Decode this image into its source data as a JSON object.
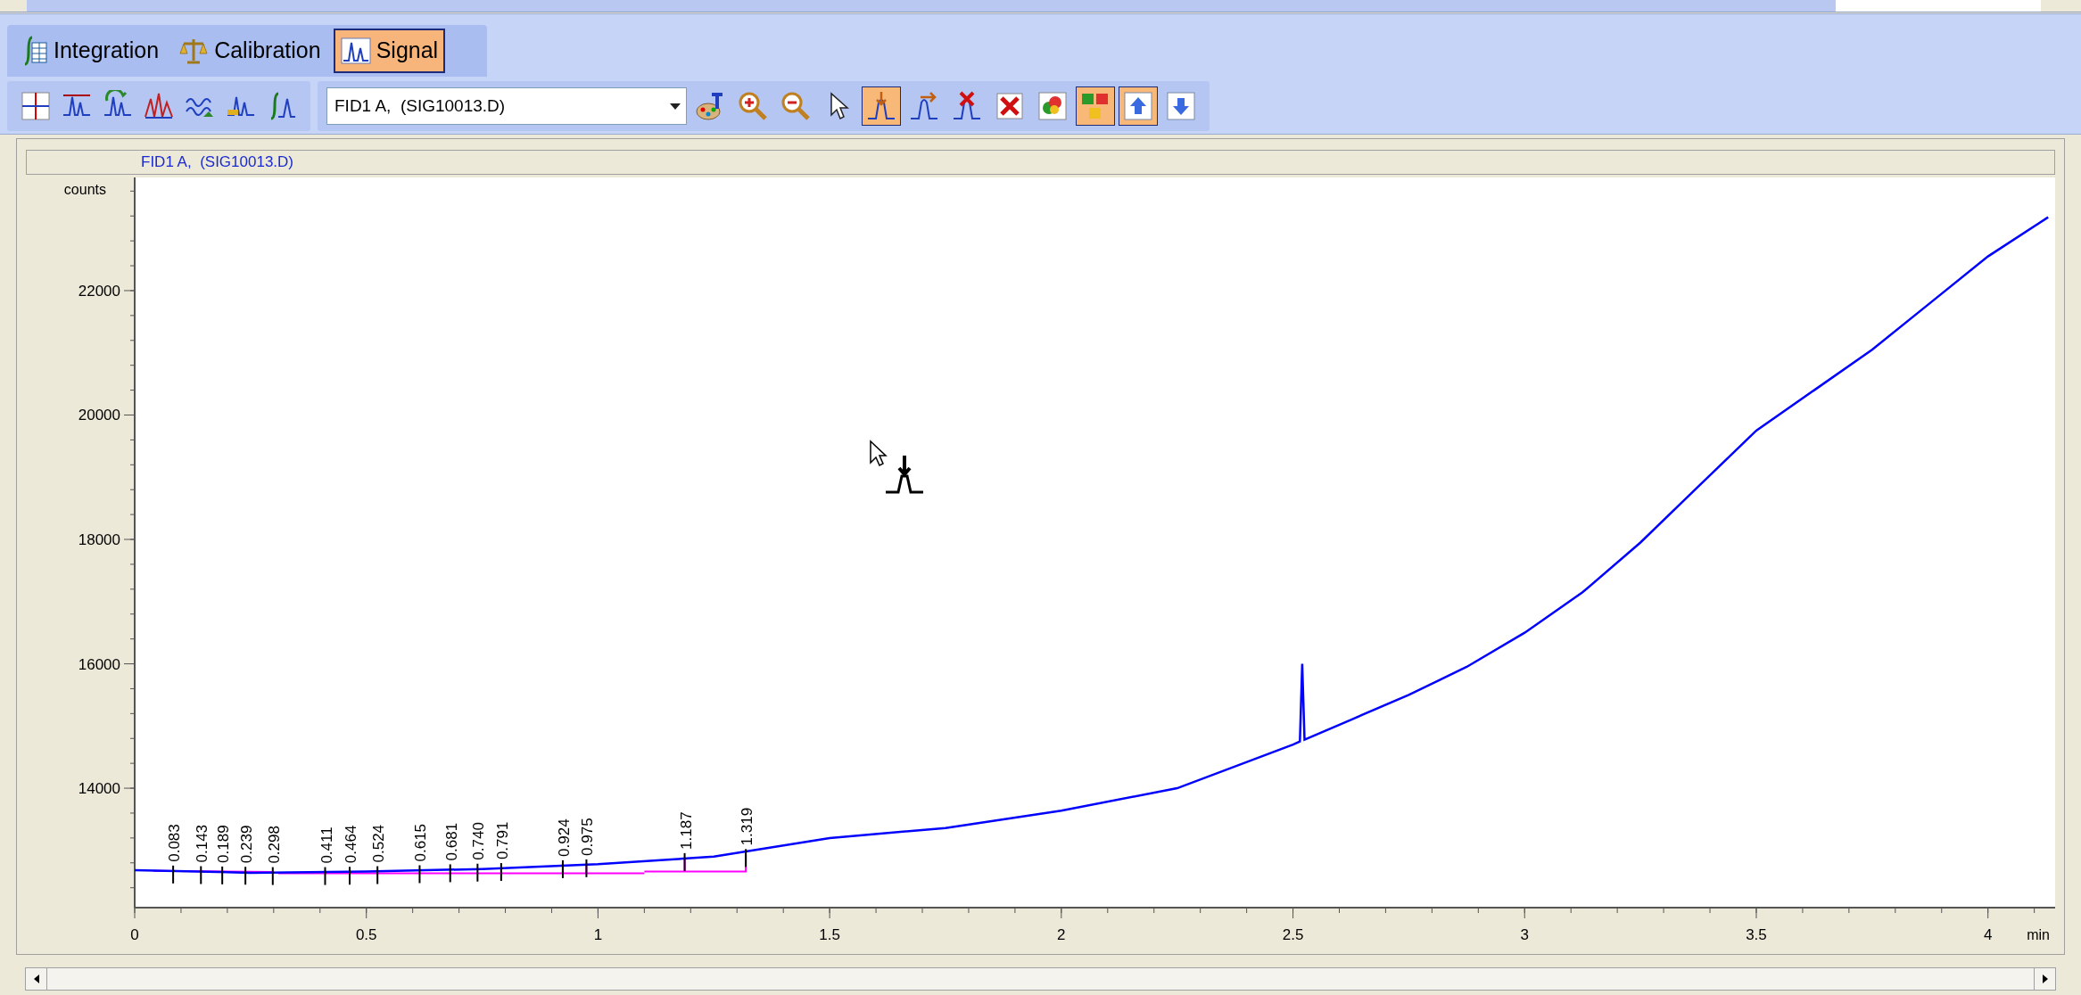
{
  "tabs": [
    {
      "label": "Integration",
      "kind": "integration",
      "selected": false
    },
    {
      "label": "Calibration",
      "kind": "calibration",
      "selected": false
    },
    {
      "label": "Signal",
      "kind": "signal",
      "selected": true
    }
  ],
  "toolbar": {
    "left_tools": [
      {
        "kind": "baseline-grid",
        "selected": false
      },
      {
        "kind": "peaks",
        "selected": false
      },
      {
        "kind": "peak-rotate",
        "selected": false
      },
      {
        "kind": "multi-peaks",
        "selected": false
      },
      {
        "kind": "wave-arrow",
        "selected": false
      },
      {
        "kind": "peaks-bars",
        "selected": false
      },
      {
        "kind": "integral-peak",
        "selected": false
      }
    ],
    "signal_select": {
      "value": "FID1 A,  (SIG10013.D)"
    },
    "right_tools": [
      {
        "kind": "font-palette",
        "selected": false
      },
      {
        "kind": "zoom-in",
        "selected": false
      },
      {
        "kind": "zoom-out",
        "selected": false
      },
      {
        "kind": "pointer",
        "selected": false
      },
      {
        "kind": "peak-down",
        "selected": true
      },
      {
        "kind": "peak-right",
        "selected": false
      },
      {
        "kind": "peak-delete",
        "selected": false
      },
      {
        "kind": "delete",
        "selected": false
      },
      {
        "kind": "color-circles",
        "selected": false
      },
      {
        "kind": "color-squares",
        "selected": true
      },
      {
        "kind": "arrow-up",
        "selected": true
      },
      {
        "kind": "arrow-down",
        "selected": false
      }
    ]
  },
  "chart_panel": {
    "title": "FID1 A,  (SIG10013.D)",
    "chart_data": {
      "type": "line",
      "ylabel": "counts",
      "xlabel": "min",
      "xlim": [
        0,
        4.145
      ],
      "ylim": [
        12080,
        23820
      ],
      "xticks": [
        0,
        0.5,
        1,
        1.5,
        2,
        2.5,
        3,
        3.5,
        4
      ],
      "yticks": [
        14000,
        16000,
        18000,
        20000,
        22000
      ],
      "x": [
        0,
        0.25,
        0.5,
        0.75,
        1,
        1.25,
        1.5,
        1.75,
        2,
        2.25,
        2.5,
        2.515,
        2.52,
        2.525,
        2.625,
        2.75,
        2.875,
        3,
        3.125,
        3.25,
        3.375,
        3.5,
        3.625,
        3.75,
        3.875,
        4,
        4.13
      ],
      "series": [
        {
          "color": "#0000ff",
          "values": [
            12680,
            12640,
            12660,
            12700,
            12780,
            12900,
            13200,
            13360,
            13640,
            14000,
            14700,
            14750,
            16000,
            14780,
            15100,
            15500,
            15950,
            16500,
            17150,
            17950,
            18850,
            19750,
            20400,
            21050,
            21800,
            22550,
            23180
          ]
        }
      ],
      "annotations": [
        {
          "x": 0.083,
          "y": 12670,
          "text": "0.083"
        },
        {
          "x": 0.143,
          "y": 12660,
          "text": "0.143"
        },
        {
          "x": 0.189,
          "y": 12655,
          "text": "0.189"
        },
        {
          "x": 0.239,
          "y": 12650,
          "text": "0.239"
        },
        {
          "x": 0.298,
          "y": 12645,
          "text": "0.298"
        },
        {
          "x": 0.411,
          "y": 12645,
          "text": "0.411"
        },
        {
          "x": 0.464,
          "y": 12650,
          "text": "0.464"
        },
        {
          "x": 0.524,
          "y": 12660,
          "text": "0.524"
        },
        {
          "x": 0.615,
          "y": 12675,
          "text": "0.615"
        },
        {
          "x": 0.681,
          "y": 12690,
          "text": "0.681"
        },
        {
          "x": 0.74,
          "y": 12700,
          "text": "0.740"
        },
        {
          "x": 0.791,
          "y": 12710,
          "text": "0.791"
        },
        {
          "x": 0.924,
          "y": 12755,
          "text": "0.924"
        },
        {
          "x": 0.975,
          "y": 12770,
          "text": "0.975"
        },
        {
          "x": 1.187,
          "y": 12870,
          "text": "1.187"
        },
        {
          "x": 1.319,
          "y": 12935,
          "text": "1.319"
        }
      ]
    }
  }
}
